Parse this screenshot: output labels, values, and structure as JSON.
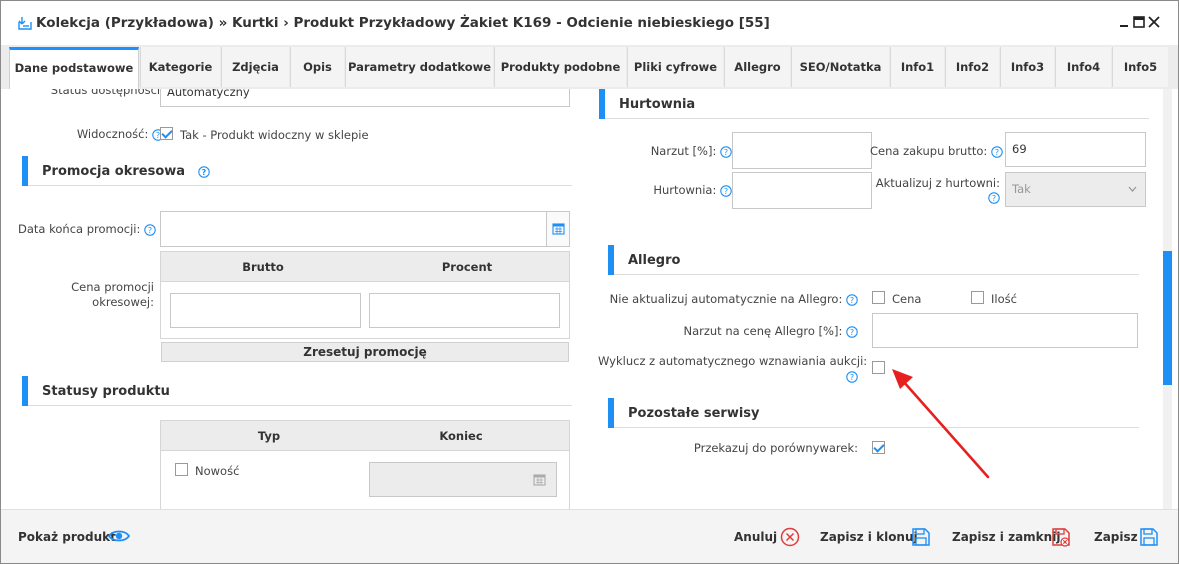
{
  "window": {
    "title": "Kolekcja (Przykładowa) » Kurtki › Produkt Przykładowy Żakiet K169 - Odcienie niebieskiego [55]",
    "accent": "#1e8ff5"
  },
  "tabs": [
    {
      "label": "Dane podstawowe",
      "active": true
    },
    {
      "label": "Kategorie"
    },
    {
      "label": "Zdjęcia"
    },
    {
      "label": "Opis"
    },
    {
      "label": "Parametry dodatkowe"
    },
    {
      "label": "Produkty podobne"
    },
    {
      "label": "Pliki cyfrowe"
    },
    {
      "label": "Allegro"
    },
    {
      "label": "SEO/Notatka"
    },
    {
      "label": "Info1"
    },
    {
      "label": "Info2"
    },
    {
      "label": "Info3"
    },
    {
      "label": "Info4"
    },
    {
      "label": "Info5"
    }
  ],
  "left": {
    "status_label": "Status dostępności:",
    "status_value": "Automatyczny",
    "visibility_label": "Widoczność:",
    "visibility_value": "Tak - Produkt widoczny w sklepie",
    "promo": {
      "title": "Promocja okresowa",
      "end_date_label": "Data końca promocji:",
      "end_date_value": "",
      "price_label": "Cena promocji okresowej:",
      "col_brutto": "Brutto",
      "col_procent": "Procent",
      "brutto_value": "",
      "procent_value": "",
      "reset_button": "Zresetuj promocję"
    },
    "statuses": {
      "title": "Statusy produktu",
      "col_typ": "Typ",
      "col_koniec": "Koniec",
      "row_new": "Nowość",
      "row_new_end": ""
    }
  },
  "right": {
    "wholesale": {
      "title": "Hurtownia",
      "markup_label": "Narzut [%]:",
      "markup_value": "",
      "purchase_label": "Cena zakupu brutto:",
      "purchase_value": "69",
      "wholesaler_label": "Hurtownia:",
      "wholesaler_value": "",
      "update_label": "Aktualizuj z hurtowni:",
      "update_value": "Tak"
    },
    "allegro": {
      "title": "Allegro",
      "no_update_label": "Nie aktualizuj automatycznie na Allegro:",
      "opt_price": "Cena",
      "opt_qty": "Ilość",
      "markup_label": "Narzut na cenę Allegro [%]:",
      "markup_value": "",
      "exclude_label": "Wyklucz z automatycznego wznawiania aukcji:"
    },
    "other": {
      "title": "Pozostałe serwisy",
      "compare_label": "Przekazuj do porównywarek:"
    }
  },
  "footer": {
    "show_product": "Pokaż produkt",
    "cancel": "Anuluj",
    "save_clone": "Zapisz i klonuj",
    "save_close": "Zapisz i zamknij",
    "save": "Zapisz"
  }
}
